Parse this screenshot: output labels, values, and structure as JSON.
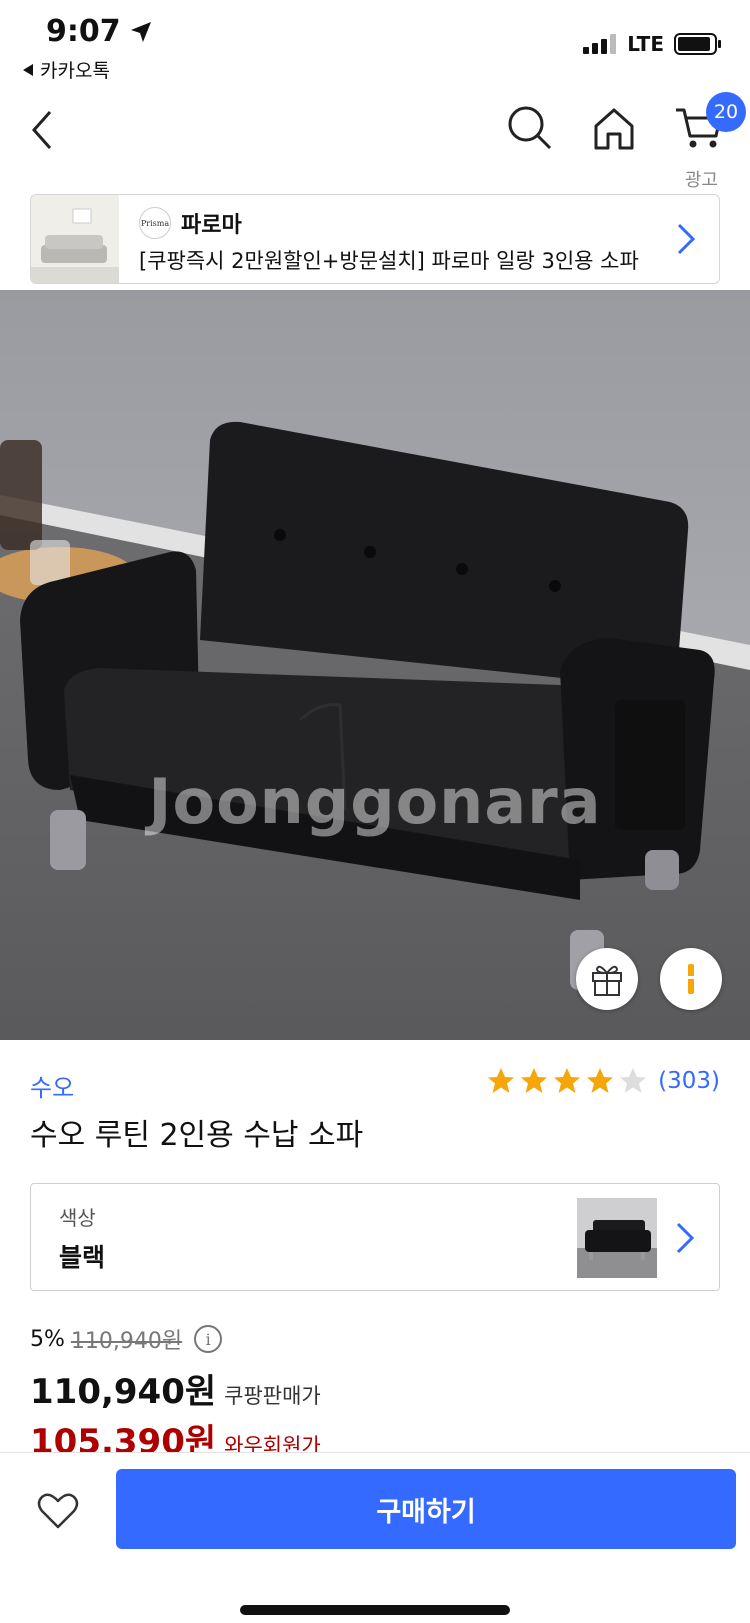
{
  "status_bar": {
    "time": "9:07",
    "network": "LTE",
    "back_app": "카카오톡"
  },
  "nav": {
    "cart_count": "20",
    "icons": [
      "back-arrow-icon",
      "search-icon",
      "home-icon",
      "cart-icon"
    ]
  },
  "ad": {
    "label": "광고",
    "logo_text": "Prisma",
    "brand": "파로마",
    "title": "[쿠팡즉시 2만원할인+방문설치] 파로마 일랑 3인용 소파"
  },
  "product_image": {
    "watermark": "Joonggonara",
    "buttons": [
      "gift-icon",
      "more-icon"
    ]
  },
  "product": {
    "brand": "수오",
    "title": "수오 루틴 2인용 수납 소파",
    "rating_value": 4,
    "rating_max": 5,
    "rating_count": "(303)"
  },
  "option": {
    "label": "색상",
    "value": "블랙"
  },
  "price": {
    "discount": "5%",
    "original": "110,940원",
    "info_icon": "i",
    "sale": "110,940원",
    "sale_label": "쿠팡판매가",
    "wow": "105,390원",
    "wow_label": "와우회원가"
  },
  "bottom_bar": {
    "buy_label": "구매하기"
  },
  "colors": {
    "accent": "#346aff",
    "wow_red": "#ae0000",
    "star": "#f6a609"
  }
}
